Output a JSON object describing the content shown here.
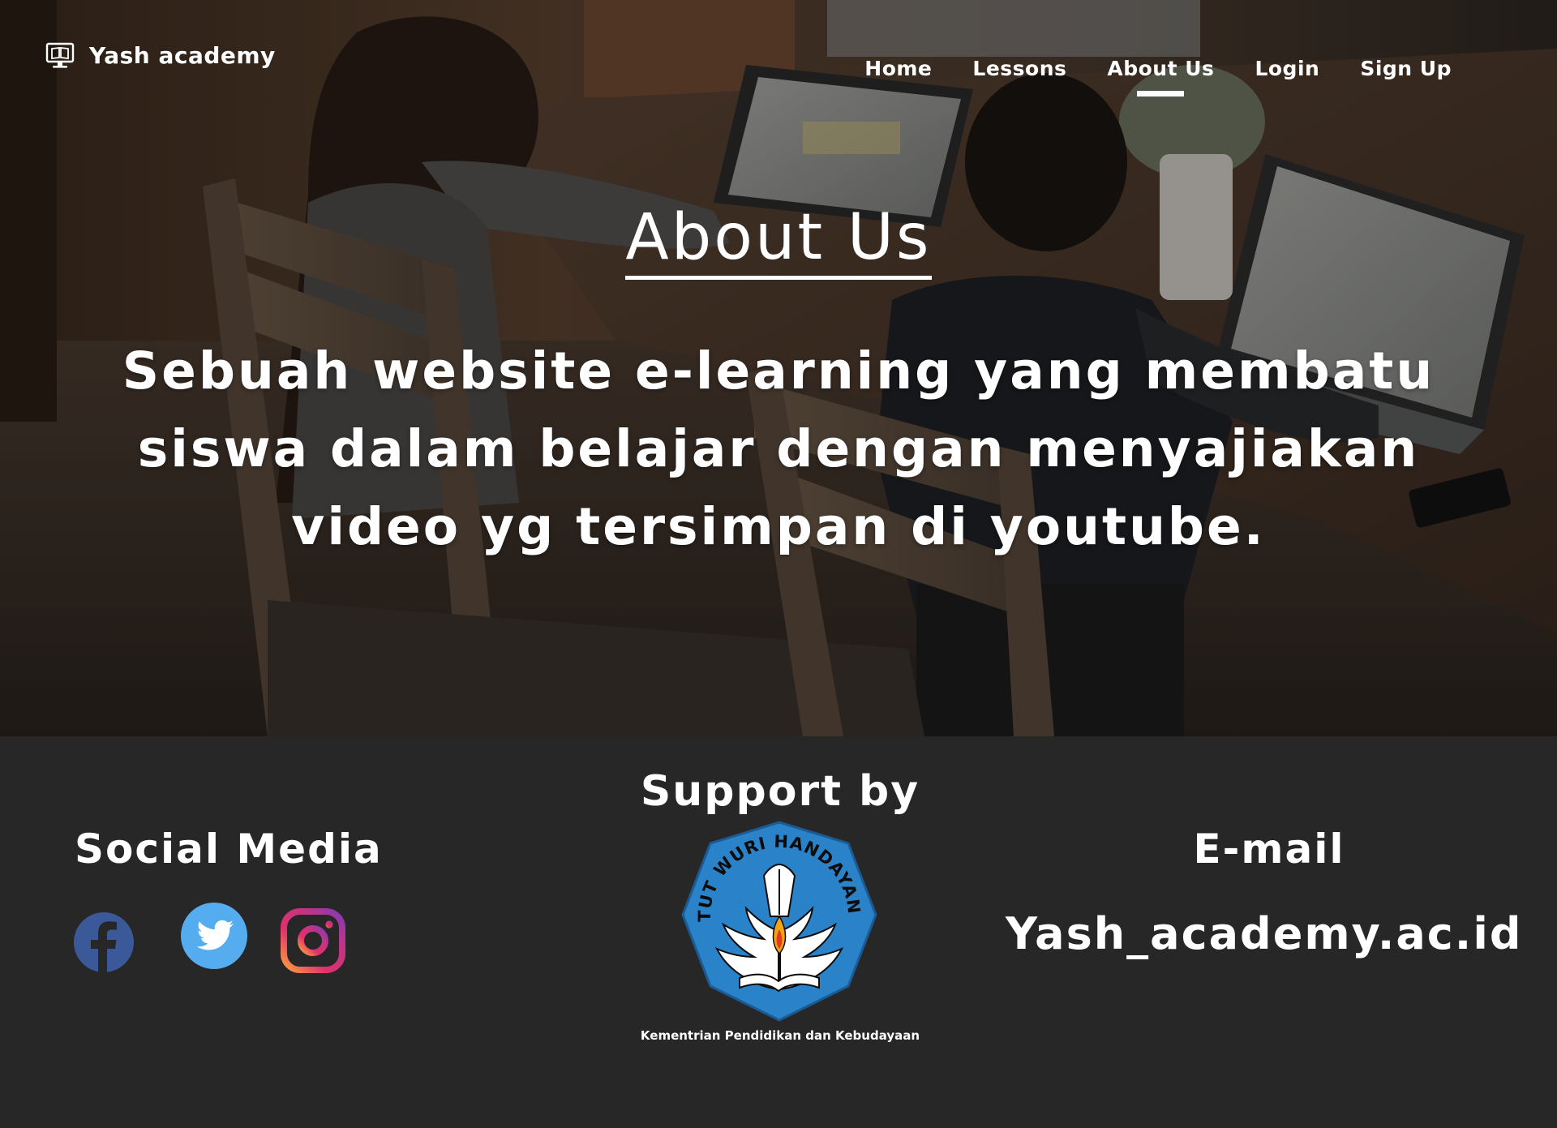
{
  "brand": {
    "name": "Yash academy",
    "icon": "monitor-book-icon"
  },
  "nav": {
    "items": [
      {
        "label": "Home"
      },
      {
        "label": "Lessons"
      },
      {
        "label": "About Us",
        "active": true
      },
      {
        "label": "Login"
      },
      {
        "label": "Sign Up"
      }
    ]
  },
  "hero": {
    "title": "About Us",
    "description": "Sebuah website e-learning yang membatu siswa dalam belajar dengan menyajiakan video yg tersimpan di youtube."
  },
  "footer": {
    "social": {
      "title": "Social Media",
      "icons": [
        "facebook-icon",
        "twitter-icon",
        "instagram-icon"
      ]
    },
    "support": {
      "title": "Support by",
      "logo_text": "TUT WURI HANDAYANI",
      "caption": "Kementrian Pendidikan dan Kebudayaan"
    },
    "email": {
      "title": "E-mail",
      "value": "Yash_academy.ac.id"
    }
  },
  "colors": {
    "footer_bg": "#272727",
    "facebook": "#3b5998",
    "twitter": "#55acee",
    "kemdikbud_blue": "#2a83c9",
    "text": "#ffffff"
  }
}
